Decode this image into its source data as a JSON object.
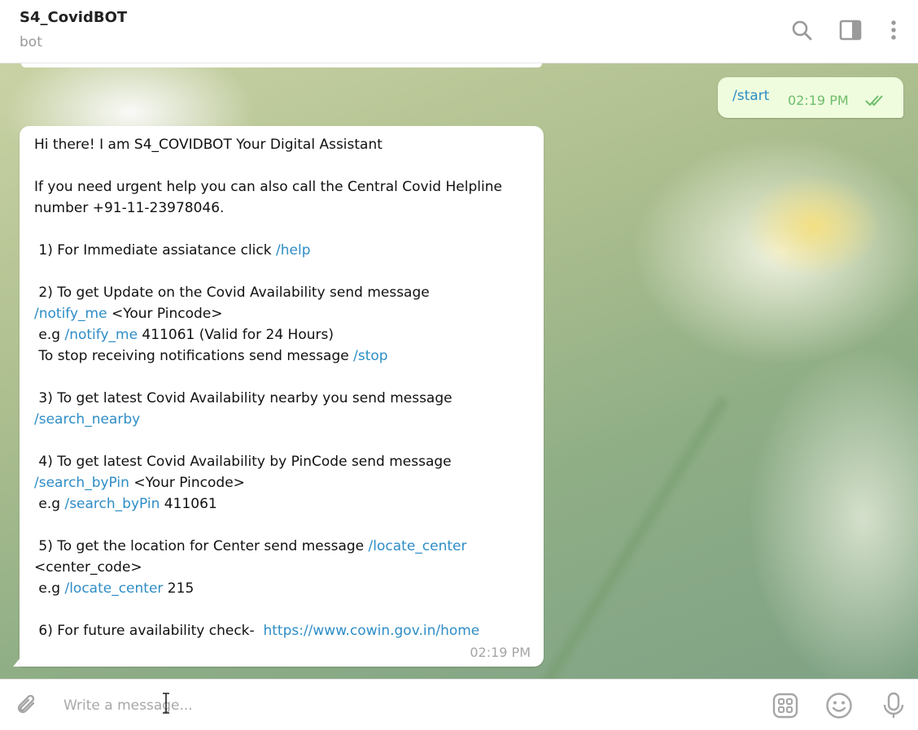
{
  "header": {
    "title": "S4_CovidBOT",
    "status": "bot",
    "icons": [
      "search-icon",
      "sidebar-toggle-icon",
      "more-vertical-icon"
    ]
  },
  "messages": {
    "outgoing": {
      "text": "/start",
      "time": "02:19 PM",
      "status_icon": "double-check-icon"
    },
    "incoming": {
      "time": "02:19 PM",
      "lines": [
        [
          {
            "t": "Hi there! I am S4_COVIDBOT Your Digital Assistant"
          }
        ],
        [],
        [
          {
            "t": "If you need urgent help you can also call the Central Covid Helpline"
          }
        ],
        [
          {
            "t": "number +91-11-23978046."
          }
        ],
        [],
        [
          {
            "t": " 1) For Immediate assiatance click "
          },
          {
            "t": "/help",
            "link": true
          }
        ],
        [],
        [
          {
            "t": " 2) To get Update on the Covid Availability send message"
          }
        ],
        [
          {
            "t": "/notify_me",
            "link": true
          },
          {
            "t": " <Your Pincode>"
          }
        ],
        [
          {
            "t": " e.g "
          },
          {
            "t": "/notify_me",
            "link": true
          },
          {
            "t": " 411061 (Valid for 24 Hours)"
          }
        ],
        [
          {
            "t": " To stop receiving notifications send message "
          },
          {
            "t": "/stop",
            "link": true
          }
        ],
        [],
        [
          {
            "t": " 3) To get latest Covid Availability nearby you send message"
          }
        ],
        [
          {
            "t": "/search_nearby",
            "link": true
          }
        ],
        [],
        [
          {
            "t": " 4) To get latest Covid Availability by PinCode send message"
          }
        ],
        [
          {
            "t": "/search_byPin",
            "link": true
          },
          {
            "t": " <Your Pincode>"
          }
        ],
        [
          {
            "t": " e.g "
          },
          {
            "t": "/search_byPin",
            "link": true
          },
          {
            "t": " 411061"
          }
        ],
        [],
        [
          {
            "t": " 5) To get the location for Center send message "
          },
          {
            "t": "/locate_center",
            "link": true
          }
        ],
        [
          {
            "t": "<center_code>"
          }
        ],
        [
          {
            "t": " e.g "
          },
          {
            "t": "/locate_center",
            "link": true
          },
          {
            "t": " 215"
          }
        ],
        [],
        [
          {
            "t": " 6) For future availability check-  "
          },
          {
            "t": "https://www.cowin.gov.in/home",
            "link": true
          }
        ]
      ]
    }
  },
  "composer": {
    "placeholder": "Write a message...",
    "value": "",
    "icons": [
      "attach-icon",
      "bot-commands-icon",
      "emoji-icon",
      "microphone-icon"
    ]
  },
  "colors": {
    "link": "#2e8dc6",
    "outgoing_bubble": "#effdde",
    "outgoing_time": "#6fbd6b",
    "incoming_bubble": "#ffffff"
  }
}
